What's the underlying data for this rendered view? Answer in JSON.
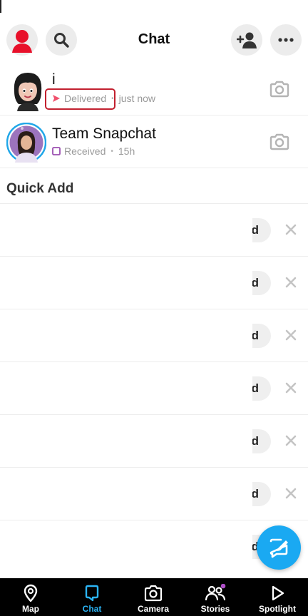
{
  "header": {
    "title": "Chat",
    "profile_icon": "bitmoji-avatar-icon",
    "search_icon": "search-icon",
    "add_friend_icon": "add-friend-icon",
    "more_icon": "more-dots-icon"
  },
  "chats": [
    {
      "name": "i",
      "status": "Delivered",
      "status_icon": "sent-arrow-icon",
      "time": "just now",
      "status_color": "#f0516d"
    },
    {
      "name": "Team Snapchat",
      "status": "Received",
      "status_icon": "received-square-icon",
      "time": "15h",
      "status_color": "#9b4fb0"
    }
  ],
  "quick_add": {
    "title": "Quick Add",
    "rows": [
      {
        "button_label": "d"
      },
      {
        "button_label": "d"
      },
      {
        "button_label": "d"
      },
      {
        "button_label": "d"
      },
      {
        "button_label": "d"
      },
      {
        "button_label": "d"
      },
      {
        "button_label": "d"
      }
    ]
  },
  "fab": {
    "icon": "new-chat-icon",
    "color": "#1aa9f2"
  },
  "nav": {
    "active_color": "#2bb4f5",
    "items": [
      {
        "label": "Map",
        "icon": "map-pin-icon"
      },
      {
        "label": "Chat",
        "icon": "chat-bubble-icon"
      },
      {
        "label": "Camera",
        "icon": "camera-icon"
      },
      {
        "label": "Stories",
        "icon": "friends-icon"
      },
      {
        "label": "Spotlight",
        "icon": "play-icon"
      }
    ]
  }
}
